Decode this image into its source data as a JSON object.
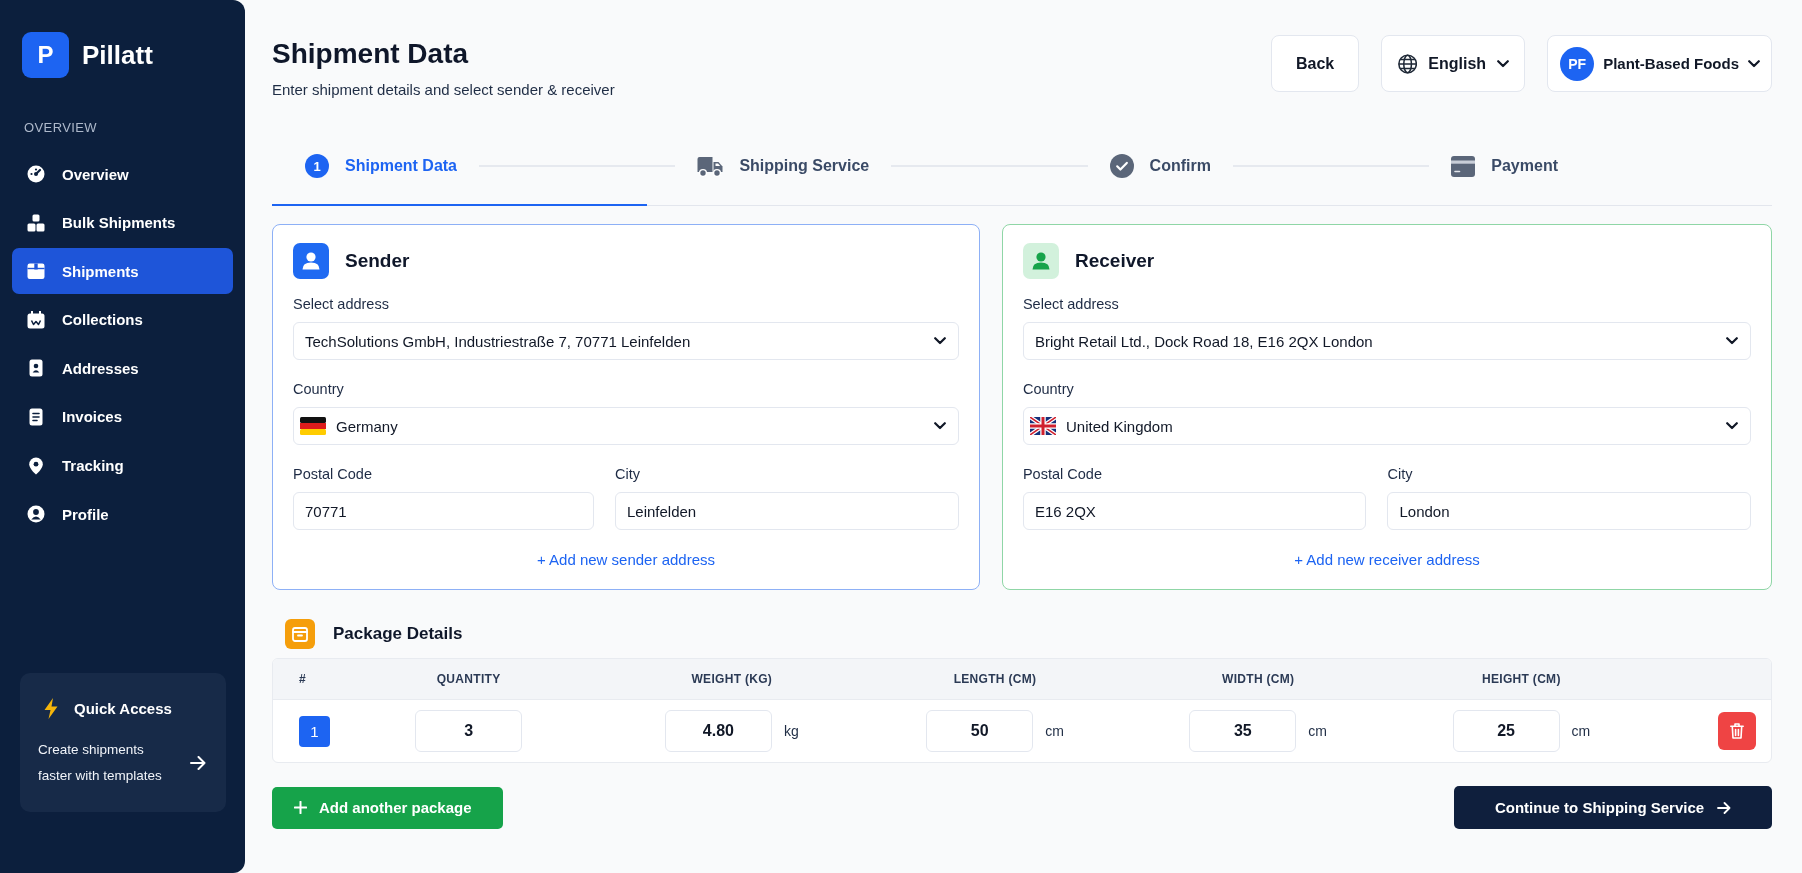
{
  "sidebar": {
    "logo": {
      "letter": "P",
      "name": "Pillatt"
    },
    "section_label": "OVERVIEW",
    "items": [
      {
        "label": "Overview",
        "selected": false
      },
      {
        "label": "Bulk Shipments",
        "selected": false
      },
      {
        "label": "Shipments",
        "selected": true
      },
      {
        "label": "Collections",
        "selected": false
      },
      {
        "label": "Addresses",
        "selected": false
      },
      {
        "label": "Invoices",
        "selected": false
      },
      {
        "label": "Tracking",
        "selected": false
      },
      {
        "label": "Profile",
        "selected": false
      }
    ],
    "quick_access": {
      "title": "Quick Access",
      "text": "Create shipments faster with templates"
    }
  },
  "header": {
    "title": "Shipment Data",
    "subtitle": "Enter shipment details and select sender & receiver",
    "back_button": "Back",
    "language": "English",
    "account": {
      "initials": "PF",
      "name": "Plant-Based Foods"
    }
  },
  "steps": [
    {
      "number": "1",
      "label": "Shipment Data",
      "selected": true
    },
    {
      "label": "Shipping Service",
      "selected": false
    },
    {
      "label": "Confirm",
      "selected": false
    },
    {
      "label": "Payment",
      "selected": false
    }
  ],
  "parties": [
    {
      "kind": "sender",
      "title": "Sender",
      "address_label": "Select address",
      "address": "TechSolutions GmbH, Industriestraße 7, 70771 Leinfelden",
      "country_label": "Country",
      "country": "Germany",
      "postal_code_label": "Postal Code",
      "postal_code": "70771",
      "city_label": "City",
      "city": "Leinfelden",
      "add_link": "+ Add new sender address"
    },
    {
      "kind": "receiver",
      "title": "Receiver",
      "address_label": "Select address",
      "address": "Bright Retail Ltd., Dock Road 18, E16 2QX London",
      "country_label": "Country",
      "country": "United Kingdom",
      "postal_code_label": "Postal Code",
      "postal_code": "E16 2QX",
      "city_label": "City",
      "city": "London",
      "add_link": "+ Add new receiver address"
    }
  ],
  "package_details": {
    "title": "Package Details",
    "columns": [
      "#",
      "QUANTITY",
      "WEIGHT (KG)",
      "LENGTH (CM)",
      "WIDTH (CM)",
      "HEIGHT (CM)"
    ],
    "rows": [
      {
        "cells": [
          {
            "kind": "index",
            "value": "1"
          },
          {
            "kind": "input",
            "value": "3"
          },
          {
            "kind": "input",
            "value": "4.80",
            "unit": "kg"
          },
          {
            "kind": "input",
            "value": "50",
            "unit": "cm"
          },
          {
            "kind": "input",
            "value": "35",
            "unit": "cm"
          },
          {
            "kind": "input",
            "value": "25",
            "unit": "cm"
          }
        ]
      }
    ]
  },
  "actions": {
    "add_package": "Add another package",
    "continue": "Continue to Shipping Service"
  }
}
